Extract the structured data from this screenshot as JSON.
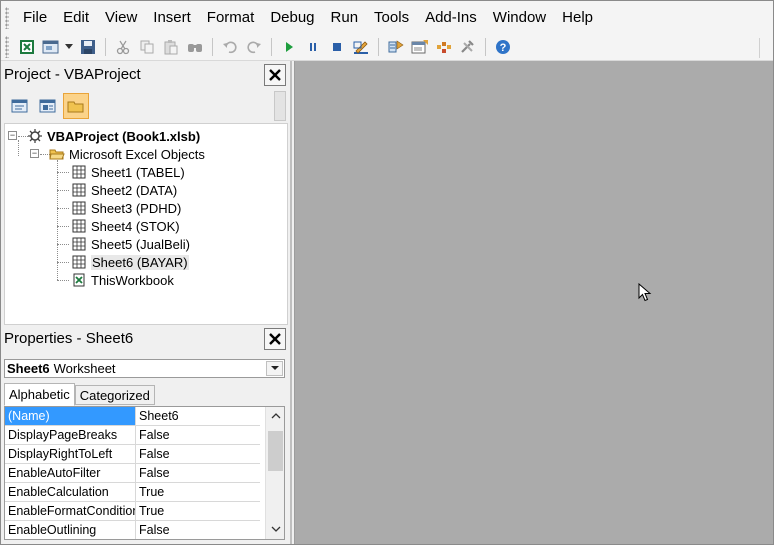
{
  "menu": {
    "items": [
      {
        "label": "File",
        "id": "file"
      },
      {
        "label": "Edit",
        "id": "edit"
      },
      {
        "label": "View",
        "id": "view"
      },
      {
        "label": "Insert",
        "id": "insert"
      },
      {
        "label": "Format",
        "id": "format"
      },
      {
        "label": "Debug",
        "id": "debug"
      },
      {
        "label": "Run",
        "id": "run"
      },
      {
        "label": "Tools",
        "id": "tools"
      },
      {
        "label": "Add-Ins",
        "id": "addins"
      },
      {
        "label": "Window",
        "id": "window"
      },
      {
        "label": "Help",
        "id": "help"
      }
    ]
  },
  "toolbar": {
    "icons": [
      "view-excel-icon",
      "insert-userform-icon",
      "dropdown-arrow-icon",
      "save-icon",
      "cut-icon",
      "copy-icon",
      "paste-icon",
      "find-icon",
      "undo-icon",
      "redo-icon",
      "run-icon",
      "break-icon",
      "reset-icon",
      "design-mode-icon",
      "project-explorer-icon",
      "properties-window-icon",
      "object-browser-icon",
      "toolbox-icon",
      "help-icon"
    ]
  },
  "project_panel": {
    "title": "Project - VBAProject",
    "tools": [
      "view-code-icon",
      "view-object-icon",
      "toggle-folders-icon"
    ],
    "tree": {
      "root": "VBAProject (Book1.xlsb)",
      "folder": "Microsoft Excel Objects",
      "items": [
        "Sheet1 (TABEL)",
        "Sheet2 (DATA)",
        "Sheet3 (PDHD)",
        "Sheet4 (STOK)",
        "Sheet5 (JualBeli)",
        "Sheet6 (BAYAR)",
        "ThisWorkbook"
      ],
      "selected_index": 5
    }
  },
  "properties_panel": {
    "title": "Properties - Sheet6",
    "object_name": "Sheet6",
    "object_type": "Worksheet",
    "tabs": [
      "Alphabetic",
      "Categorized"
    ],
    "active_tab": "Alphabetic",
    "rows": [
      {
        "name": "(Name)",
        "value": "Sheet6"
      },
      {
        "name": "DisplayPageBreaks",
        "value": "False"
      },
      {
        "name": "DisplayRightToLeft",
        "value": "False"
      },
      {
        "name": "EnableAutoFilter",
        "value": "False"
      },
      {
        "name": "EnableCalculation",
        "value": "True"
      },
      {
        "name": "EnableFormatConditionsCalculation",
        "value": "True"
      },
      {
        "name": "EnableOutlining",
        "value": "False"
      }
    ]
  },
  "colors": {
    "workspace": "#ababab",
    "selection": "#3399ff",
    "active_tool": "#fbd38a"
  }
}
